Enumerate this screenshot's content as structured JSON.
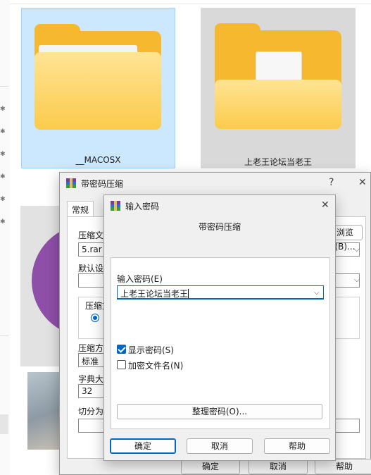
{
  "explorer": {
    "items": [
      {
        "name": "__MACOSX"
      },
      {
        "name": "上老王论坛当老王"
      }
    ]
  },
  "main_dialog": {
    "title": "带密码压缩",
    "help_glyph": "?",
    "tab_general": "常规",
    "archive_name_label": "压缩文",
    "archive_name_value": "5.rar",
    "browse_button": "浏览(B)...",
    "default_profile_label": "默认设",
    "format_group_label": "压缩文",
    "method_label": "压缩方",
    "method_value": "标准",
    "dict_label": "字典大",
    "dict_value": "32",
    "split_label": "切分为",
    "ok_button": "确定",
    "cancel_button": "取消",
    "help_button": "帮助"
  },
  "password_dialog": {
    "title": "输入密码",
    "header": "带密码压缩",
    "password_label": "输入密码(E)",
    "password_value": "上老王论坛当老王",
    "show_password_label": "显示密码(S)",
    "show_password_checked": true,
    "encrypt_names_label": "加密文件名(N)",
    "encrypt_names_checked": false,
    "organize_button": "整理密码(O)...",
    "ok_button": "确定",
    "cancel_button": "取消",
    "help_button": "帮助"
  },
  "colors": {
    "selection_bg": "#cce8ff",
    "folder_yellow": "#f5b82e",
    "accent": "#0067c0"
  }
}
